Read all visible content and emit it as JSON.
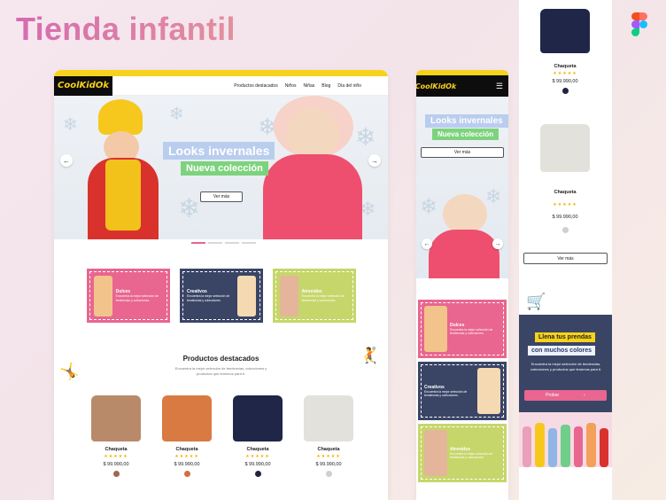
{
  "page_title": "Tienda infantil",
  "brand": "CoolKidOk",
  "colors": {
    "accent_yellow": "#f7d21b",
    "pink": "#e8668f",
    "navy": "#3a4566",
    "green": "#c7d66a"
  },
  "desktop": {
    "nav": [
      "Productos destacados",
      "Niños",
      "Niñas",
      "Blog",
      "Día del niño"
    ],
    "hero": {
      "tag1": "Looks invernales",
      "tag2": "Nueva colección",
      "button": "Ver más",
      "prev_icon": "chevron-left-icon",
      "next_icon": "chevron-right-icon"
    },
    "categories": [
      {
        "title": "Dulces",
        "desc": "Encuentra la mejor selección de tendencias y colecciones."
      },
      {
        "title": "Creativos",
        "desc": "Encuentra la mejor selección de tendencias y colecciones."
      },
      {
        "title": "Atrevidos",
        "desc": "Encuentra la mejor selección de tendencias y colecciones."
      }
    ],
    "featured": {
      "title": "Productos destacados",
      "subtitle": "Encuentra la mejor selección de tendencias, colecciones y productos que tenemos para ti.",
      "products": [
        {
          "name": "Chaqueta",
          "stars": "★★★★★",
          "price": "$ 99.990,00",
          "swatch": "#9b6a4d",
          "color": "#b88a6a"
        },
        {
          "name": "Chaqueta",
          "stars": "★★★★★",
          "price": "$ 99.990,00",
          "swatch": "#d2703f",
          "color": "#d97a43"
        },
        {
          "name": "Chaqueta",
          "stars": "★★★★★",
          "price": "$ 99.990,00",
          "swatch": "#20243f",
          "color": "#1f2647"
        },
        {
          "name": "Chaqueta",
          "stars": "★★★★★",
          "price": "$ 99.990,00",
          "swatch": "#cfcfcf",
          "color": "#e3e1dc"
        }
      ]
    }
  },
  "mobile": {
    "menu_icon": "hamburger-menu-icon",
    "hero": {
      "tag1": "Looks invernales",
      "tag2": "Nueva colección",
      "button": "Ver más"
    },
    "categories": [
      {
        "title": "Dulces",
        "desc": "Encuentra la mejor selección de tendencias y colecciones."
      },
      {
        "title": "Creativos",
        "desc": "Encuentra la mejor selección de tendencias y colecciones."
      },
      {
        "title": "Atrevidos",
        "desc": "Encuentra la mejor selección de tendencias y colecciones."
      }
    ]
  },
  "side": {
    "products": [
      {
        "name": "Chaqueta",
        "stars": "★★★★★",
        "price": "$ 99.990,00",
        "swatch": "#20243f",
        "color": "#1f2647"
      },
      {
        "name": "Chaqueta",
        "stars": "★★★★★",
        "price": "$ 99.990,00",
        "swatch": "#cfcfcf",
        "color": "#e3e1dc"
      }
    ],
    "button": "Ver más",
    "banner": {
      "tag1": "Llena tus prendas",
      "tag2": "con muchos colores",
      "text": "Encuentra la mejor selección de tendencias, colecciones y productos que tenemos para ti.",
      "button": "Probar",
      "button_icon": "chevron-right-icon"
    }
  }
}
